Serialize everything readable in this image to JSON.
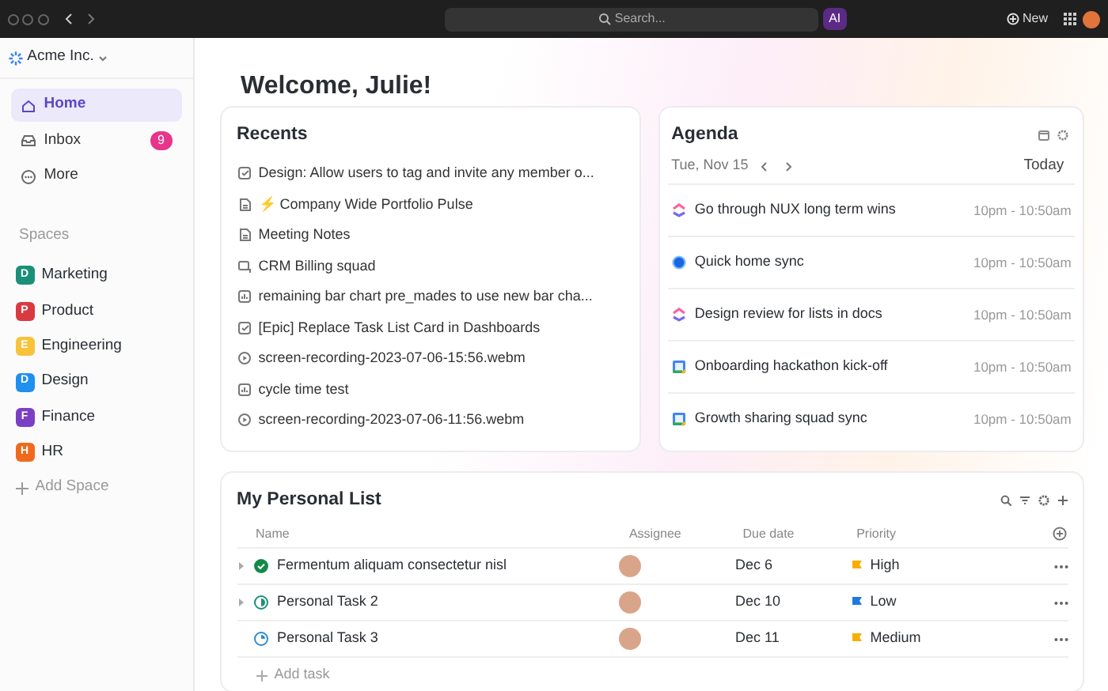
{
  "topbar": {
    "search_placeholder": "Search...",
    "ai": "AI",
    "new": "New"
  },
  "sidebar": {
    "workspace": "Acme Inc.",
    "nav": [
      {
        "kind": "home",
        "label": "Home",
        "selected": true
      },
      {
        "kind": "inbox",
        "label": "Inbox",
        "selected": false,
        "badge": "9"
      },
      {
        "kind": "more",
        "label": "More",
        "selected": false
      }
    ],
    "spaces_heading": "Spaces",
    "spaces": [
      {
        "letter": "D",
        "name": "Marketing",
        "color": "#1a8f7a"
      },
      {
        "letter": "P",
        "name": "Product",
        "color": "#d93a40"
      },
      {
        "letter": "E",
        "name": "Engineering",
        "color": "#f8c23a"
      },
      {
        "letter": "D",
        "name": "Design",
        "color": "#1f8ff0"
      },
      {
        "letter": "F",
        "name": "Finance",
        "color": "#7b3fc4"
      },
      {
        "letter": "H",
        "name": "HR",
        "color": "#ef6a1c"
      }
    ],
    "add_space": "Add Space"
  },
  "welcome": "Welcome, Julie!",
  "recents": {
    "title": "Recents",
    "items": [
      {
        "kind": "task",
        "text": "Design: Allow users to tag and invite any member o..."
      },
      {
        "kind": "doc",
        "emoji": "⚡",
        "text": "Company Wide Portfolio Pulse"
      },
      {
        "kind": "doc",
        "text": "Meeting Notes"
      },
      {
        "kind": "chat",
        "text": "CRM Billing squad"
      },
      {
        "kind": "dashboard",
        "text": "remaining bar chart pre_mades to use new bar cha..."
      },
      {
        "kind": "task",
        "text": "[Epic] Replace Task List Card in Dashboards"
      },
      {
        "kind": "video",
        "text": "screen-recording-2023-07-06-15:56.webm"
      },
      {
        "kind": "dashboard",
        "text": "cycle time test"
      },
      {
        "kind": "video",
        "text": "screen-recording-2023-07-06-11:56.webm"
      }
    ]
  },
  "agenda": {
    "title": "Agenda",
    "date": "Tue, Nov 15",
    "today": "Today",
    "events": [
      {
        "kind": "app",
        "title": "Go through NUX long term wins",
        "time": "10pm - 10:50am"
      },
      {
        "kind": "dot",
        "title": "Quick home sync",
        "time": "10pm - 10:50am"
      },
      {
        "kind": "app",
        "title": "Design review for lists in docs",
        "time": "10pm - 10:50am"
      },
      {
        "kind": "calendar",
        "title": "Onboarding hackathon kick-off",
        "time": "10pm - 10:50am"
      },
      {
        "kind": "calendar",
        "title": "Growth sharing squad sync",
        "time": "10pm - 10:50am"
      }
    ]
  },
  "list": {
    "title": "My Personal List",
    "columns": [
      "Name",
      "Assignee",
      "Due date",
      "Priority"
    ],
    "tasks": [
      {
        "name": "Fermentum aliquam consectetur nisl",
        "kind": "done",
        "expandable": true,
        "due": "Dec 6",
        "priority": "High",
        "color": "#f8ae00"
      },
      {
        "name": "Personal Task 2",
        "kind": "progress",
        "expandable": true,
        "due": "Dec 10",
        "priority": "Low",
        "color": "#1f7ae0"
      },
      {
        "name": "Personal Task 3",
        "kind": "review",
        "expandable": false,
        "due": "Dec 11",
        "priority": "Medium",
        "color": "#f8ae00"
      }
    ],
    "add_task": "Add task"
  }
}
